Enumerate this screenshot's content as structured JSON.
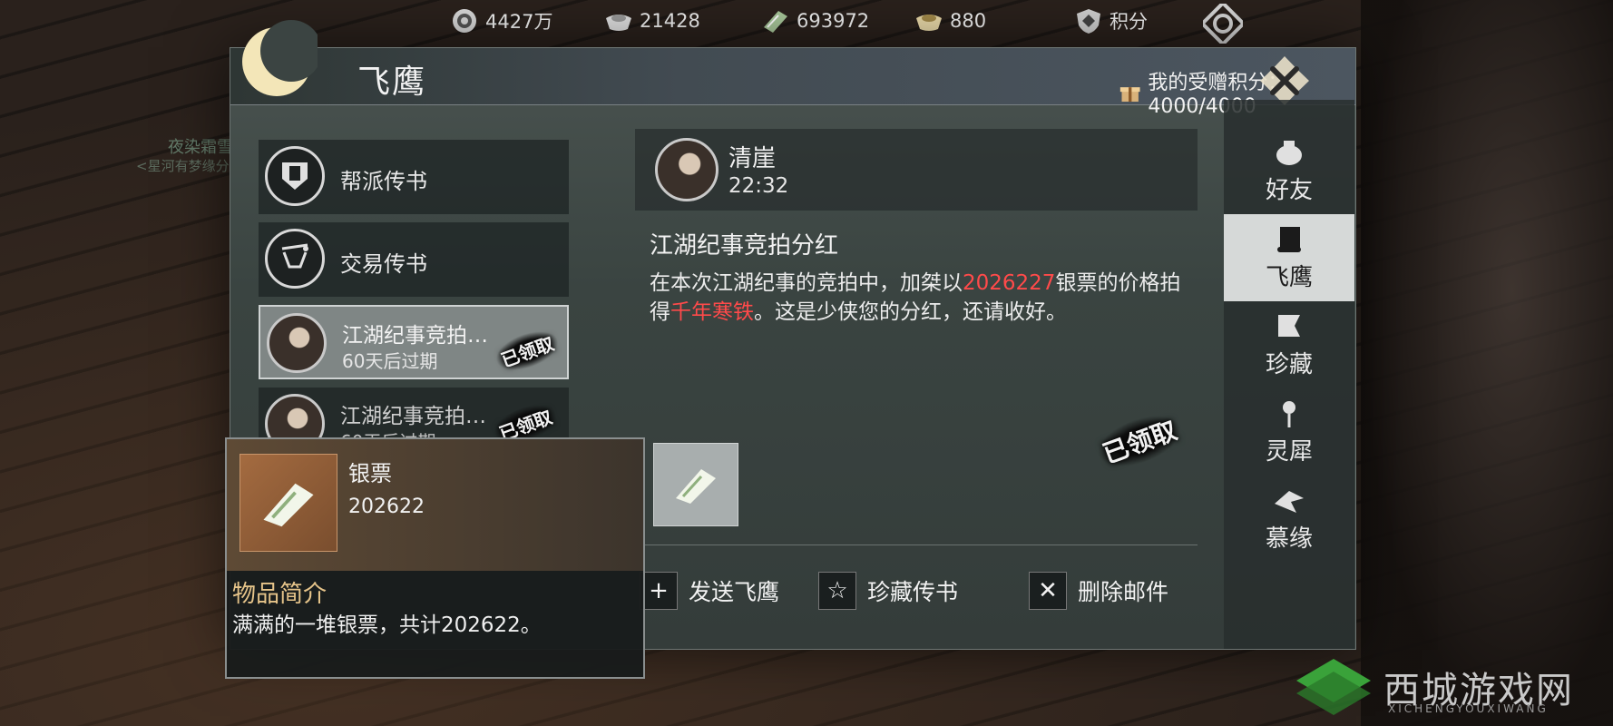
{
  "currencies": [
    {
      "icon": "coin-bag-icon",
      "value": "4427万"
    },
    {
      "icon": "silver-ingot-icon",
      "value": "21428"
    },
    {
      "icon": "silver-note-icon",
      "value": "693972"
    },
    {
      "icon": "gold-ingot-icon",
      "value": "880"
    },
    {
      "icon": "shield-points-icon",
      "value": "积分"
    }
  ],
  "window": {
    "title": "飞鹰",
    "gift_points_label": "我的受赠积分：4000/4000"
  },
  "background": {
    "player_name": "夜染霜雪",
    "player_title": "<星河有梦缘分"
  },
  "left_list": [
    {
      "type": "category",
      "icon": "guild-banner-icon",
      "label": "帮派传书"
    },
    {
      "type": "category",
      "icon": "scale-icon",
      "label": "交易传书"
    },
    {
      "type": "mail",
      "title": "江湖纪事竞拍…",
      "expire": "60天后过期",
      "stamp": "已领取",
      "selected": true
    },
    {
      "type": "mail",
      "title": "江湖纪事竞拍…",
      "expire": "60天后过期",
      "stamp": "已领取",
      "selected": false
    }
  ],
  "mail": {
    "sender": "清崖",
    "time": "22:32",
    "subject": "江湖纪事竞拍分红",
    "body_part1": "在本次江湖纪事的竞拍中，加桀以",
    "body_amount": "2026227",
    "body_part2": "银票的价格拍得",
    "body_item": "千年寒铁",
    "body_part3": "。这是少侠您的分红，还请收好。",
    "claimed_stamp": "已领取"
  },
  "actions": {
    "send": "发送飞鹰",
    "collect": "珍藏传书",
    "delete": "删除邮件"
  },
  "tabs": [
    {
      "icon": "teapot-icon",
      "label": "好友",
      "active": false
    },
    {
      "icon": "scroll-icon",
      "label": "飞鹰",
      "active": true
    },
    {
      "icon": "flag-icon",
      "label": "珍藏",
      "active": false
    },
    {
      "icon": "spirit-icon",
      "label": "灵犀",
      "active": false
    },
    {
      "icon": "origami-crane-icon",
      "label": "慕缘",
      "active": false
    }
  ],
  "tooltip": {
    "item_name": "银票",
    "item_count": "202622",
    "section_title": "物品简介",
    "description": "满满的一堆银票，共计202622。"
  },
  "watermark": {
    "text": "西城游戏网",
    "sub": "XICHENGYOUXIWANG"
  },
  "colors": {
    "highlight_red": "#ff4a4a",
    "active_tab": "#d6d9d8",
    "tooltip_title": "#e6c48a"
  }
}
